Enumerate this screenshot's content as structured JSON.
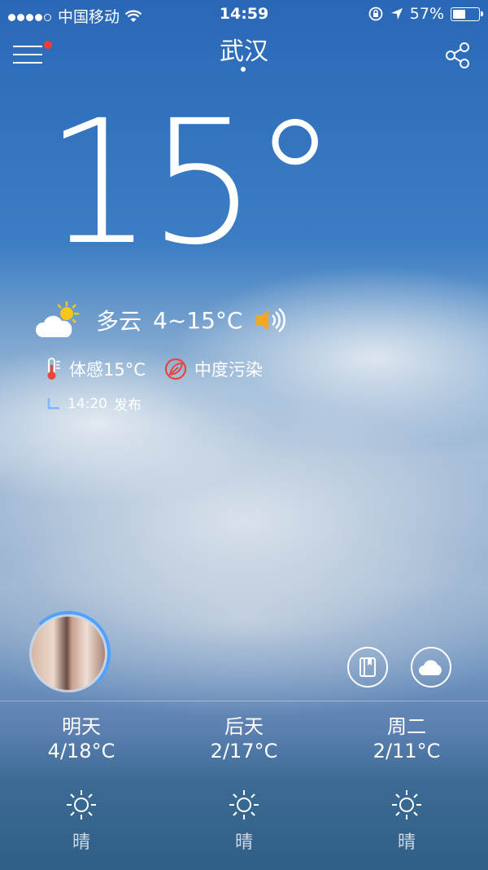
{
  "status_bar": {
    "carrier": "中国移动",
    "time": "14:59",
    "battery_text": "57%",
    "battery_level": 0.57
  },
  "header": {
    "city": "武汉"
  },
  "current": {
    "temperature": "15°",
    "condition": "多云",
    "range": "4~15°C",
    "feels_like": "体感15°C",
    "air_quality": "中度污染",
    "publish_time": "14:20",
    "publish_label": "发布"
  },
  "forecast": [
    {
      "day": "明天",
      "range": "4/18°C",
      "condition": "晴",
      "icon": "sun-icon"
    },
    {
      "day": "后天",
      "range": "2/17°C",
      "condition": "晴",
      "icon": "sun-icon"
    },
    {
      "day": "周二",
      "range": "2/11°C",
      "condition": "晴",
      "icon": "sun-icon"
    }
  ],
  "colors": {
    "menu_badge": "#ff3b30",
    "speaker": "#f5a623",
    "thermometer": "#e8453c",
    "air_quality_icon": "#e8453c",
    "publish_icon": "#7fb4ff",
    "avatar_ring": "#4da3ff"
  }
}
